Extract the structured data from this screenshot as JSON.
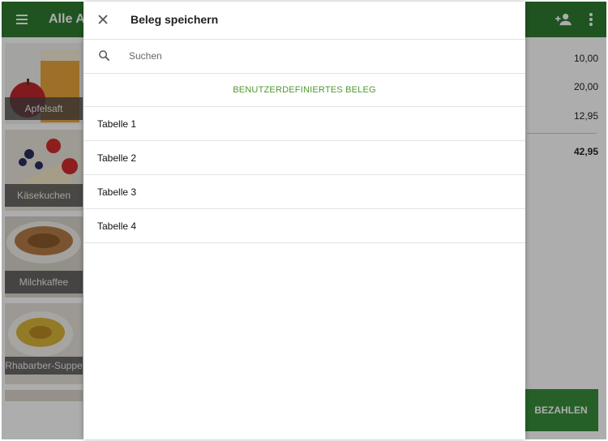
{
  "appbar": {
    "title": "Alle Artikel"
  },
  "products": [
    {
      "name": "Apfelsaft"
    },
    {
      "name": "Käsekuchen"
    },
    {
      "name": "Milchkaffee"
    },
    {
      "name": "Rhabarber-Suppe"
    }
  ],
  "order": {
    "amounts": [
      "10,00",
      "20,00",
      "12,95"
    ],
    "total": "42,95",
    "pay_label": "BEZAHLEN"
  },
  "dialog": {
    "title": "Beleg speichern",
    "search_placeholder": "Suchen",
    "custom_label": "BENUTZERDEFINIERTES BELEG",
    "tables": [
      "Tabelle 1",
      "Tabelle 2",
      "Tabelle 3",
      "Tabelle 4"
    ]
  },
  "colors": {
    "primary": "#2e7d32",
    "accent": "#4e9a2e",
    "pay": "#388e3c"
  },
  "icons": [
    "menu-icon",
    "add-person-icon",
    "more-vert-icon",
    "close-icon",
    "search-icon"
  ]
}
